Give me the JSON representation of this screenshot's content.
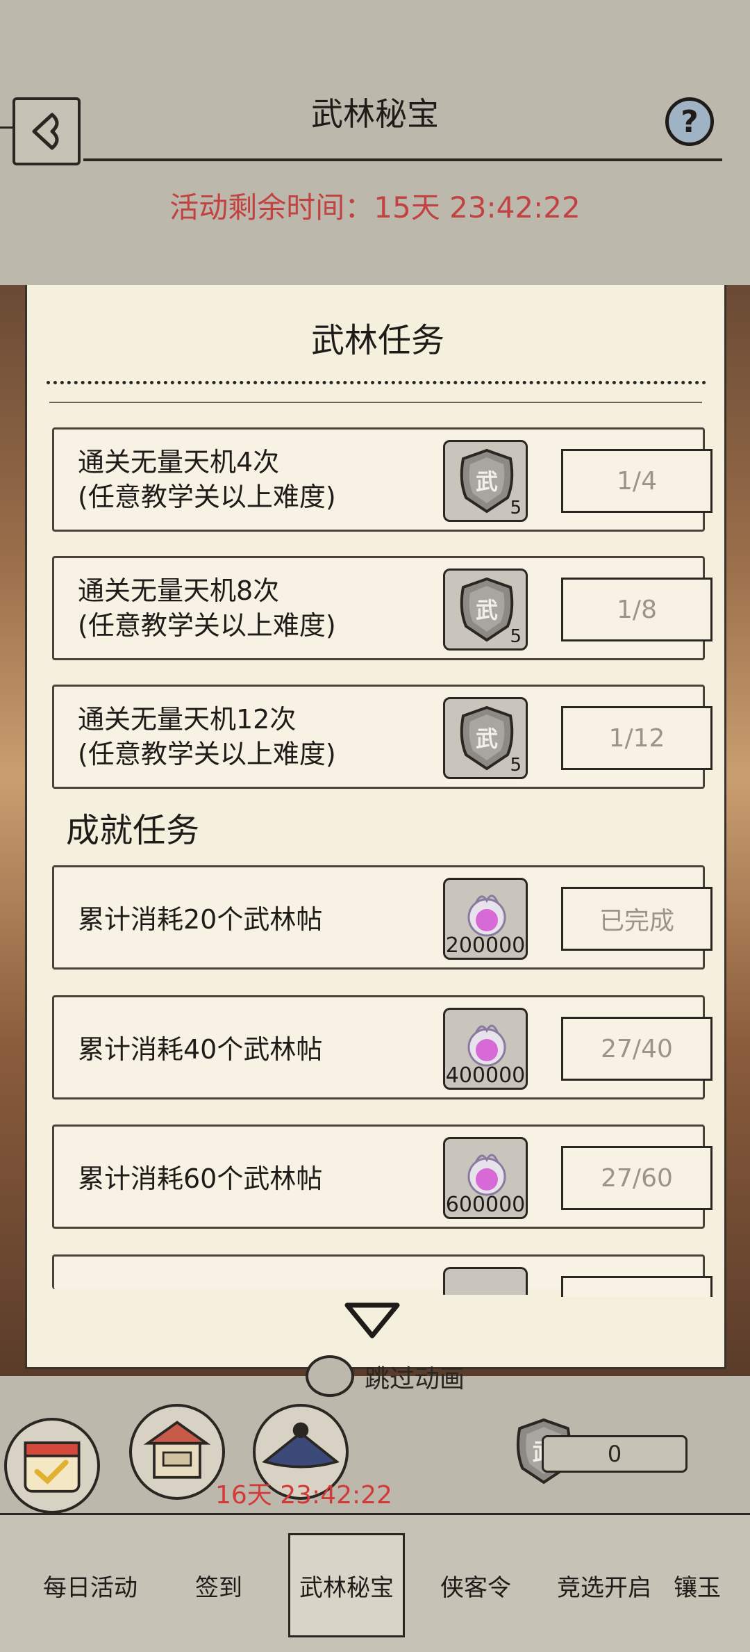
{
  "header": {
    "title": "武林秘宝",
    "timer_label": "活动剩余时间：15天 23:42:22"
  },
  "panel": {
    "title": "武林任务",
    "wulin_tasks": [
      {
        "line1": "通关无量天机4次",
        "line2": "(任意教学关以上难度)",
        "reward_count": "5",
        "progress": "1/4"
      },
      {
        "line1": "通关无量天机8次",
        "line2": "(任意教学关以上难度)",
        "reward_count": "5",
        "progress": "1/8"
      },
      {
        "line1": "通关无量天机12次",
        "line2": "(任意教学关以上难度)",
        "reward_count": "5",
        "progress": "1/12"
      }
    ],
    "achievement_title": "成就任务",
    "achievement_tasks": [
      {
        "text": "累计消耗20个武林帖",
        "reward_count": "200000",
        "progress": "已完成"
      },
      {
        "text": "累计消耗40个武林帖",
        "reward_count": "400000",
        "progress": "27/40"
      },
      {
        "text": "累计消耗60个武林帖",
        "reward_count": "600000",
        "progress": "27/60"
      }
    ]
  },
  "bottom": {
    "skip_label": "跳过动画",
    "event_timer": "16天 23:42:22",
    "currency_value": "0"
  },
  "tabs": [
    {
      "label": "每日活动",
      "active": false
    },
    {
      "label": "签到",
      "active": false
    },
    {
      "label": "武林秘宝",
      "active": true
    },
    {
      "label": "侠客令",
      "active": false
    },
    {
      "label": "竞选开启",
      "active": false
    },
    {
      "label": "镶玉",
      "active": false
    }
  ],
  "icons": {
    "back": "back-arrow-icon",
    "help": "question-icon",
    "token": "wu-shield-token-icon",
    "orb": "purple-orb-icon",
    "scroll": "triangle-down-icon"
  },
  "colors": {
    "timer_red": "#c24242",
    "panel_bg": "#f5efdd",
    "progress_gray": "#9a948a"
  }
}
